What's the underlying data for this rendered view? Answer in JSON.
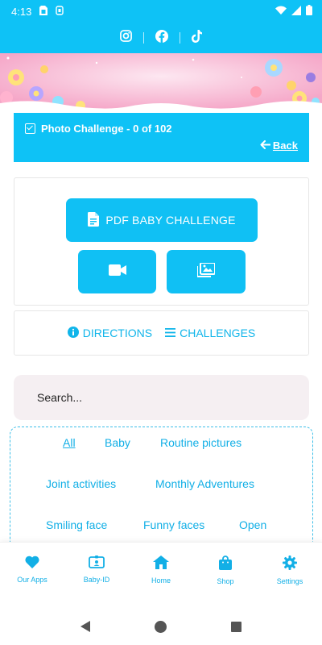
{
  "status_bar": {
    "time": "4:13"
  },
  "social": {
    "icons": [
      "instagram-icon",
      "facebook-icon",
      "tiktok-icon"
    ]
  },
  "challenge": {
    "title": "Photo Challenge - 0 of 102",
    "back_label": "Back"
  },
  "actions": {
    "pdf_label": "PDF BABY CHALLENGE",
    "video_icon": "video-camera-icon",
    "gallery_icon": "image-gallery-icon"
  },
  "links": {
    "directions": "DIRECTIONS",
    "challenges": "CHALLENGES"
  },
  "search": {
    "placeholder": "Search..."
  },
  "categories": [
    "All",
    "Baby",
    "Routine pictures",
    "Joint activities",
    "Monthly Adventures",
    "Smiling face",
    "Funny faces",
    "Open"
  ],
  "active_category": "All",
  "bottom_nav": [
    {
      "label": "Our Apps",
      "icon": "heart-icon"
    },
    {
      "label": "Baby-ID",
      "icon": "id-card-icon"
    },
    {
      "label": "Home",
      "icon": "home-icon"
    },
    {
      "label": "Shop",
      "icon": "shopping-bag-icon"
    },
    {
      "label": "Settings",
      "icon": "gear-icon"
    }
  ],
  "colors": {
    "accent": "#0ec2f6",
    "link": "#12afe6",
    "search_bg": "#f5eff2"
  }
}
